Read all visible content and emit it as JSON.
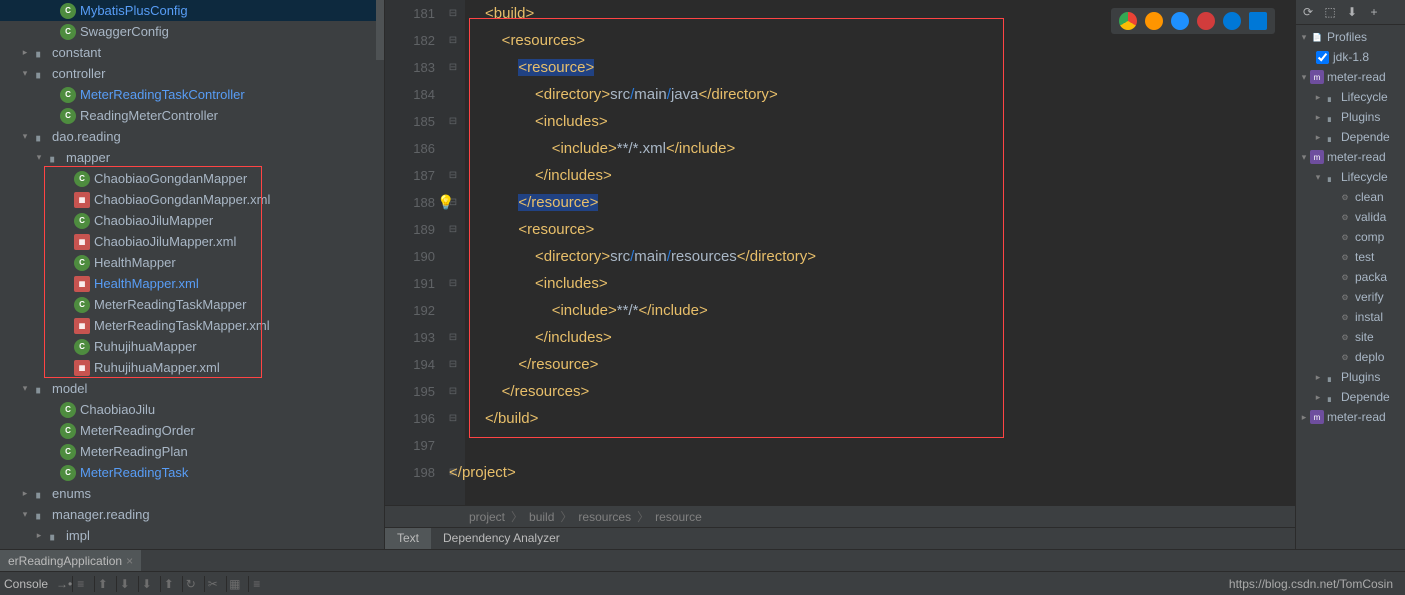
{
  "tree": {
    "items": [
      {
        "indent": 3,
        "icon": "class",
        "iconChar": "C",
        "label": "MybatisPlusConfig",
        "highlighted": true
      },
      {
        "indent": 3,
        "icon": "class",
        "iconChar": "C",
        "label": "SwaggerConfig"
      },
      {
        "indent": 1,
        "arrow": "▸",
        "icon": "folder",
        "iconChar": "📁",
        "label": "constant"
      },
      {
        "indent": 1,
        "arrow": "▾",
        "icon": "folder",
        "iconChar": "📁",
        "label": "controller"
      },
      {
        "indent": 3,
        "icon": "class",
        "iconChar": "C",
        "label": "MeterReadingTaskController",
        "highlighted": true
      },
      {
        "indent": 3,
        "icon": "class",
        "iconChar": "C",
        "label": "ReadingMeterController"
      },
      {
        "indent": 1,
        "arrow": "▾",
        "icon": "folder",
        "iconChar": "📁",
        "label": "dao.reading"
      },
      {
        "indent": 2,
        "arrow": "▾",
        "icon": "folder",
        "iconChar": "📁",
        "label": "mapper"
      },
      {
        "indent": 4,
        "icon": "class",
        "iconChar": "C",
        "label": "ChaobiaoGongdanMapper"
      },
      {
        "indent": 4,
        "icon": "xml",
        "iconChar": "⬚",
        "label": "ChaobiaoGongdanMapper.xml"
      },
      {
        "indent": 4,
        "icon": "class",
        "iconChar": "C",
        "label": "ChaobiaoJiluMapper"
      },
      {
        "indent": 4,
        "icon": "xml",
        "iconChar": "⬚",
        "label": "ChaobiaoJiluMapper.xml"
      },
      {
        "indent": 4,
        "icon": "class",
        "iconChar": "C",
        "label": "HealthMapper"
      },
      {
        "indent": 4,
        "icon": "xml",
        "iconChar": "⬚",
        "label": "HealthMapper.xml",
        "highlighted": true
      },
      {
        "indent": 4,
        "icon": "class",
        "iconChar": "C",
        "label": "MeterReadingTaskMapper"
      },
      {
        "indent": 4,
        "icon": "xml",
        "iconChar": "⬚",
        "label": "MeterReadingTaskMapper.xml"
      },
      {
        "indent": 4,
        "icon": "class",
        "iconChar": "C",
        "label": "RuhujihuaMapper"
      },
      {
        "indent": 4,
        "icon": "xml",
        "iconChar": "⬚",
        "label": "RuhujihuaMapper.xml"
      },
      {
        "indent": 1,
        "arrow": "▾",
        "icon": "folder",
        "iconChar": "📁",
        "label": "model"
      },
      {
        "indent": 3,
        "icon": "class",
        "iconChar": "C",
        "label": "ChaobiaoJilu"
      },
      {
        "indent": 3,
        "icon": "class",
        "iconChar": "C",
        "label": "MeterReadingOrder"
      },
      {
        "indent": 3,
        "icon": "class",
        "iconChar": "C",
        "label": "MeterReadingPlan"
      },
      {
        "indent": 3,
        "icon": "class",
        "iconChar": "C",
        "label": "MeterReadingTask",
        "highlighted": true
      },
      {
        "indent": 1,
        "arrow": "▸",
        "icon": "folder",
        "iconChar": "📁",
        "label": "enums"
      },
      {
        "indent": 1,
        "arrow": "▾",
        "icon": "folder",
        "iconChar": "📁",
        "label": "manager.reading"
      },
      {
        "indent": 2,
        "arrow": "▸",
        "icon": "folder",
        "iconChar": "📁",
        "label": "impl"
      }
    ]
  },
  "gutter": [
    "181",
    "182",
    "183",
    "184",
    "185",
    "186",
    "187",
    "188",
    "189",
    "190",
    "191",
    "192",
    "193",
    "194",
    "195",
    "196",
    "197",
    "198"
  ],
  "breadcrumb": [
    "project",
    "build",
    "resources",
    "resource"
  ],
  "bottomTabs": {
    "text": "Text",
    "depAnalyzer": "Dependency Analyzer"
  },
  "runTab": "erReadingApplication",
  "consoleLabel": "Console",
  "maven": {
    "profiles": "Profiles",
    "jdk": "jdk-1.8",
    "items": [
      {
        "indent": 0,
        "arrow": "▾",
        "label": "meter-read",
        "icon": "m"
      },
      {
        "indent": 1,
        "arrow": "▸",
        "label": "Lifecycle",
        "icon": "f"
      },
      {
        "indent": 1,
        "arrow": "▸",
        "label": "Plugins",
        "icon": "f"
      },
      {
        "indent": 1,
        "arrow": "▸",
        "label": "Depende",
        "icon": "f"
      },
      {
        "indent": 0,
        "arrow": "▾",
        "label": "meter-read",
        "icon": "m"
      },
      {
        "indent": 1,
        "arrow": "▾",
        "label": "Lifecycle",
        "icon": "f"
      },
      {
        "indent": 2,
        "label": "clean",
        "icon": "g"
      },
      {
        "indent": 2,
        "label": "valida",
        "icon": "g"
      },
      {
        "indent": 2,
        "label": "comp",
        "icon": "g"
      },
      {
        "indent": 2,
        "label": "test",
        "icon": "g"
      },
      {
        "indent": 2,
        "label": "packa",
        "icon": "g"
      },
      {
        "indent": 2,
        "label": "verify",
        "icon": "g"
      },
      {
        "indent": 2,
        "label": "instal",
        "icon": "g"
      },
      {
        "indent": 2,
        "label": "site",
        "icon": "g"
      },
      {
        "indent": 2,
        "label": "deplo",
        "icon": "g"
      },
      {
        "indent": 1,
        "arrow": "▸",
        "label": "Plugins",
        "icon": "f"
      },
      {
        "indent": 1,
        "arrow": "▸",
        "label": "Depende",
        "icon": "f"
      },
      {
        "indent": 0,
        "arrow": "▸",
        "label": "meter-read",
        "icon": "m"
      }
    ]
  },
  "watermark": "https://blog.csdn.net/TomCosin",
  "browserColors": [
    "#ea4335",
    "#ff9500",
    "#1e90ff",
    "#d23c3c",
    "#0078d7",
    "#0078d7"
  ]
}
